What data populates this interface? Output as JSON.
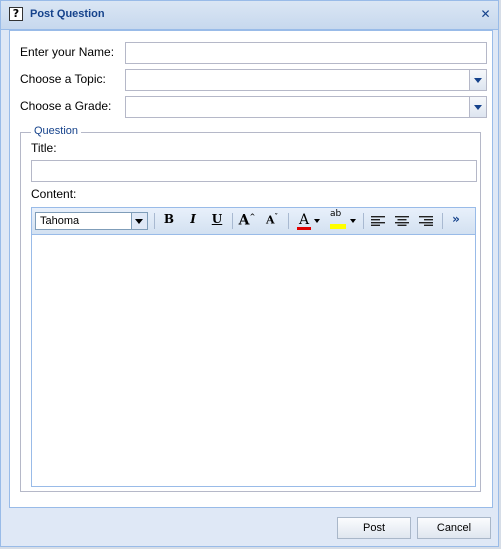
{
  "window": {
    "title": "Post Question",
    "help_icon_glyph": "?",
    "close_glyph": "✕"
  },
  "form": {
    "name_label": "Enter your Name:",
    "name_value": "",
    "topic_label": "Choose a Topic:",
    "topic_value": "",
    "grade_label": "Choose a Grade:",
    "grade_value": ""
  },
  "question": {
    "legend": "Question",
    "title_label": "Title:",
    "title_value": "",
    "content_label": "Content:"
  },
  "editor": {
    "font": "Tahoma",
    "bold_glyph": "B",
    "italic_glyph": "I",
    "underline_glyph": "U",
    "grow_glyph": "A",
    "shrink_glyph": "A",
    "font_color_glyph": "A",
    "highlight_glyph": "ab",
    "more_glyph": "»",
    "font_color": "#e00000",
    "highlight_color": "#ffff00"
  },
  "buttons": {
    "post": "Post",
    "cancel": "Cancel"
  },
  "colors": {
    "title_text": "#15428b",
    "border": "#99bbe8"
  }
}
